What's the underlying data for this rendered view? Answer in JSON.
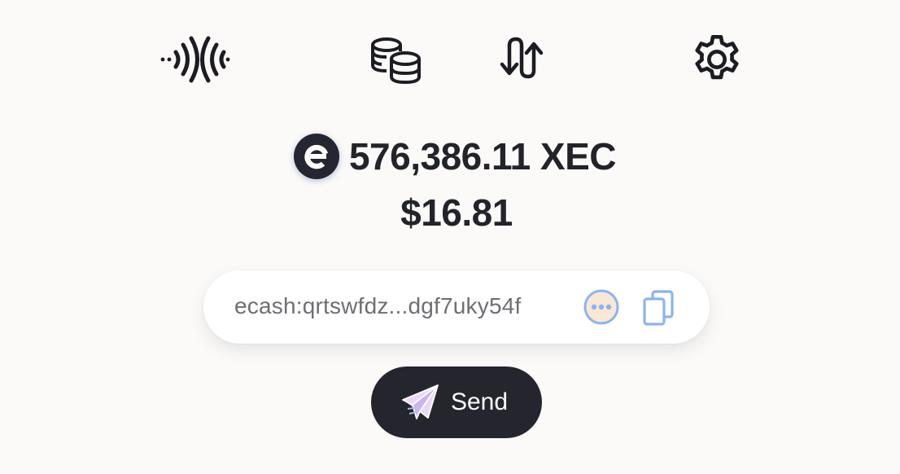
{
  "nav": {
    "items": [
      {
        "name": "receive",
        "icon": "contactless-icon"
      },
      {
        "name": "tokens",
        "icon": "coins-stack-icon"
      },
      {
        "name": "swap",
        "icon": "swap-arrows-icon"
      },
      {
        "name": "settings",
        "icon": "gear-icon"
      }
    ]
  },
  "balance": {
    "icon": "ecash-logo-icon",
    "xec": "576,386.11 XEC",
    "fiat": "$16.81"
  },
  "address": {
    "text": "ecash:qrtswfdz...dgf7uky54f",
    "more_icon": "more-dots-icon",
    "copy_icon": "copy-icon"
  },
  "send": {
    "label": "Send",
    "icon": "paper-plane-icon"
  },
  "colors": {
    "background": "#fbfaf9",
    "dark": "#25252d",
    "accent_blue": "#8cb4ee",
    "dots_fill": "#fbe7d6"
  }
}
